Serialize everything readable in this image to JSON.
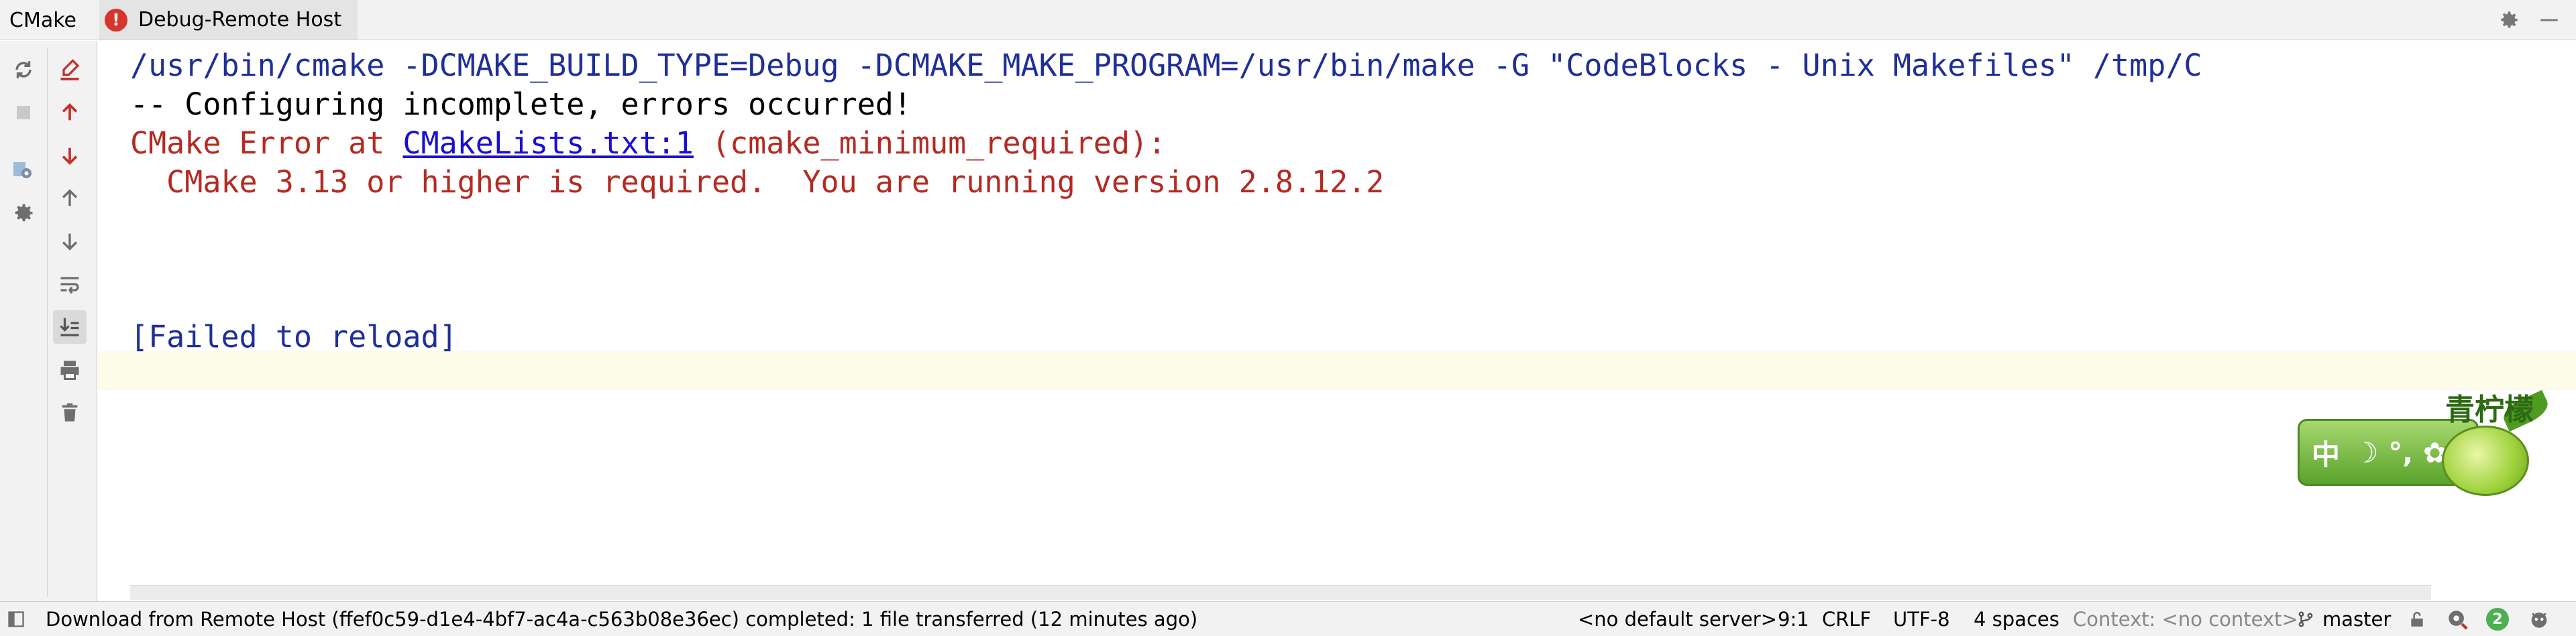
{
  "tabs": {
    "cmake": "CMake",
    "debug_remote": "Debug-Remote Host",
    "error_marker": "!"
  },
  "console": {
    "command": "/usr/bin/cmake -DCMAKE_BUILD_TYPE=Debug -DCMAKE_MAKE_PROGRAM=/usr/bin/make -G \"CodeBlocks - Unix Makefiles\" /tmp/C",
    "configuring": "-- Configuring incomplete, errors occurred!",
    "error_prefix": "CMake Error at ",
    "error_link": "CMakeLists.txt:1",
    "error_suffix": " (cmake_minimum_required):",
    "version_message": "  CMake 3.13 or higher is required.  You are running version 2.8.12.2",
    "failed": "[Failed to reload]"
  },
  "ime_widget": {
    "brand": "青柠檬",
    "mode": "中",
    "symbols": "☽ °, ✿"
  },
  "status": {
    "download_message": "Download from Remote Host (ffef0c59-d1e4-4bf7-ac4a-c563b08e36ec) completed: 1 file transferred (12 minutes ago)",
    "server": "<no default server>",
    "position": "9:1",
    "line_ending": "CRLF",
    "encoding": "UTF-8",
    "indent": "4 spaces",
    "context": "Context: <no context>",
    "branch": "master",
    "notifications": "2"
  },
  "icons": [
    "gear-icon",
    "minimize-icon",
    "reload-icon",
    "stop-icon",
    "clear-icon",
    "prev-error-icon",
    "next-error-icon",
    "up-icon",
    "down-icon",
    "cmake-settings-icon",
    "settings-icon",
    "soft-wrap-icon",
    "scroll-to-end-icon",
    "print-icon",
    "trash-icon",
    "git-branch-icon",
    "lock-icon",
    "inspector-icon",
    "memory-icon"
  ],
  "colors": {
    "command": "#1f2f99",
    "error": "#b42a22",
    "link": "#1a0dd6",
    "caret_row": "#fdfbe9",
    "error_marker": "#d9342b",
    "ime_green": "#5aa32c"
  }
}
